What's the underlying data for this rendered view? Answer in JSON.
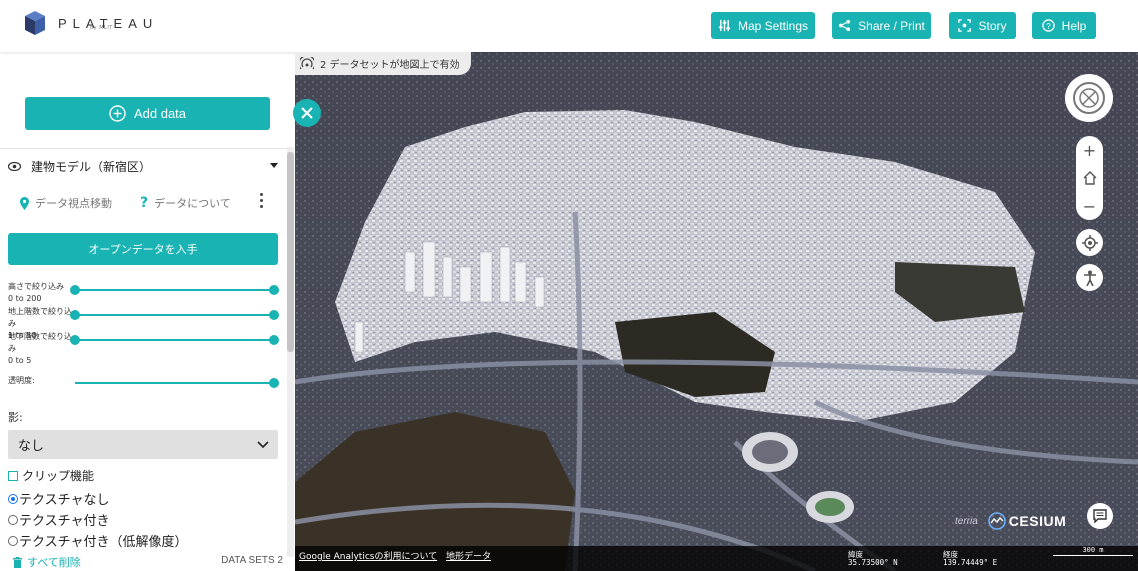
{
  "header": {
    "logo_text": "PLATEAU",
    "logo_sub": "by MLIT",
    "buttons": {
      "map_settings": "Map Settings",
      "share_print": "Share / Print",
      "story": "Story",
      "help": "Help"
    },
    "accent": "#1ab3b3"
  },
  "sidebar": {
    "add_data": "Add data",
    "layer": {
      "title": "建物モデル（新宿区）",
      "actions": {
        "zoom_to": "データ視点移動",
        "about": "データについて"
      },
      "open_data": "オープンデータを入手",
      "filters": [
        {
          "label": "高さで絞り込み",
          "range": "0 to 200",
          "min": 0,
          "max": 1
        },
        {
          "label": "地上階数で絞り込み",
          "range": "1 to 50",
          "min": 0,
          "max": 1
        },
        {
          "label": "地下階数で絞り込み",
          "range": "0 to 5",
          "min": 0,
          "max": 1
        }
      ],
      "opacity_label": "透明度:",
      "opacity_value": 1.0,
      "shadow_label": "影:",
      "shadow_value": "なし",
      "clip_label": "クリップ機能",
      "texture_options": [
        "テクスチャなし",
        "テクスチャ付き",
        "テクスチャ付き（低解像度）"
      ],
      "texture_selected": 0
    },
    "footer": {
      "remove_all": "すべて削除",
      "count": "DATA SETS 2"
    }
  },
  "map": {
    "status": "2 データセットが地図上で有効",
    "credits": {
      "terria": "terria",
      "cesium": "CESIUM"
    },
    "bottom_links": [
      "Google Analyticsの利用について",
      "地形データ"
    ],
    "coords": {
      "lat_label": "緯度",
      "lat_value": "35.73500° N",
      "lon_label": "経度",
      "lon_value": "139.74449° E"
    },
    "scale": "300 m"
  }
}
